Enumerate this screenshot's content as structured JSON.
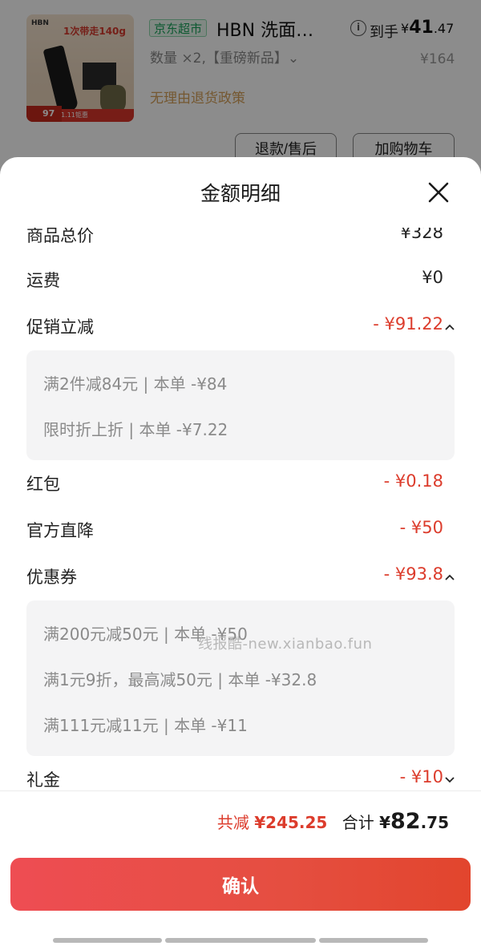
{
  "product": {
    "thumb_logo": "HBN",
    "thumb_promo": "1次带走140g",
    "thumb_bottom": "抢11.11钜惠",
    "thumb_price": "97",
    "store_tag": "京东超市",
    "name": "HBN 洗面…",
    "final_label": "到手",
    "final_price_currency": "¥",
    "final_price_int": "41",
    "final_price_dec": ".47",
    "quantity": "数量 ×2,【重磅新品】⌄",
    "unit_price": "¥164",
    "return_policy": "无理由退货政策",
    "refund_button": "退款/售后",
    "cart_button": "加购物车"
  },
  "sheet": {
    "title": "金额明细",
    "rows": {
      "goods_total": {
        "label": "商品总价",
        "amount": "¥328"
      },
      "shipping": {
        "label": "运费",
        "amount": "¥0"
      },
      "promo": {
        "label": "促销立减",
        "amount": "- ¥91.22"
      },
      "red_packet": {
        "label": "红包",
        "amount": "- ¥0.18"
      },
      "official_drop": {
        "label": "官方直降",
        "amount": "- ¥50"
      },
      "coupon": {
        "label": "优惠券",
        "amount": "- ¥93.8"
      },
      "gift_money": {
        "label": "礼金",
        "amount": "- ¥10"
      }
    },
    "promo_details": [
      "满2件减84元 | 本单 -¥84",
      "限时折上折 | 本单 -¥7.22"
    ],
    "coupon_details": [
      "满200元减50元 | 本单 -¥50",
      "满1元9折，最高减50元 | 本单 -¥32.8",
      "满111元减11元 | 本单 -¥11"
    ],
    "watermark": "线报酷-new.xianbao.fun",
    "total_reduce_label": "共减",
    "total_reduce_value": "¥245.25",
    "total_label": "合计",
    "total_currency": "¥",
    "total_int": "82",
    "total_dec": ".75",
    "confirm_button": "确认"
  },
  "colors": {
    "accent_red": "#dc3c2c",
    "store_green": "#18a35a",
    "policy_gold": "#d5a059"
  }
}
